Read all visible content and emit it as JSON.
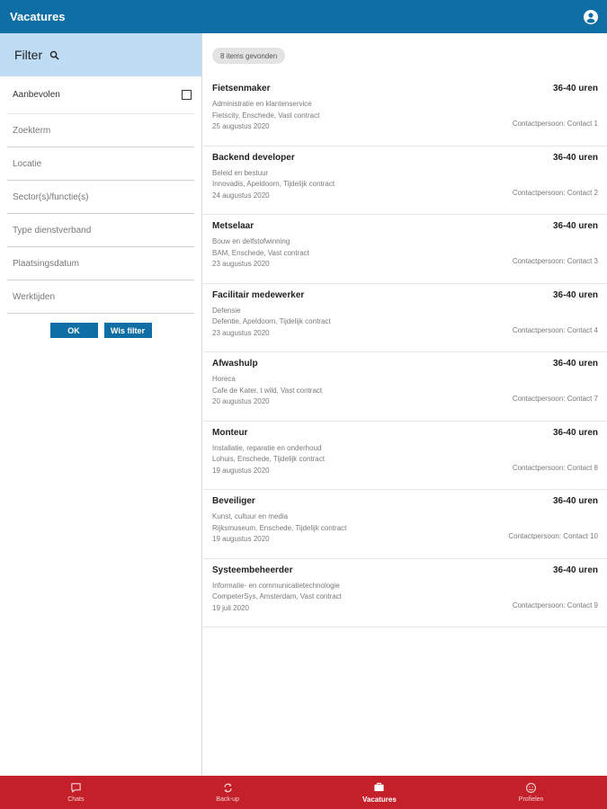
{
  "header": {
    "title": "Vacatures",
    "account_icon": "user-circle-icon"
  },
  "filter": {
    "title": "Filter",
    "search_icon": "search-icon",
    "recommended_label": "Aanbevolen",
    "fields": [
      {
        "placeholder": "Zoekterm"
      },
      {
        "placeholder": "Locatie"
      },
      {
        "placeholder": "Sector(s)/functie(s)"
      },
      {
        "placeholder": "Type dienstverband"
      },
      {
        "placeholder": "Plaatsingsdatum"
      },
      {
        "placeholder": "Werktijden"
      }
    ],
    "ok_label": "OK",
    "clear_label": "Wis filter"
  },
  "results": {
    "count_label": "8 items gevonden",
    "items": [
      {
        "title": "Fietsenmaker",
        "hours": "36-40 uren",
        "sector": "Administratie en klantenservice",
        "details": "Fietscity, Enschede, Vast contract",
        "date": "25 augustus 2020",
        "contact": "Contactpersoon: Contact 1"
      },
      {
        "title": "Backend developer",
        "hours": "36-40 uren",
        "sector": "Beleid en bestuur",
        "details": "Innovadis, Apeldoorn, Tijdelijk contract",
        "date": "24 augustus 2020",
        "contact": "Contactpersoon: Contact 2"
      },
      {
        "title": "Metselaar",
        "hours": "36-40 uren",
        "sector": "Bouw en delfstofwinning",
        "details": "BAM, Enschede, Vast contract",
        "date": "23 augustus 2020",
        "contact": "Contactpersoon: Contact 3"
      },
      {
        "title": "Facilitair medewerker",
        "hours": "36-40 uren",
        "sector": "Defensie",
        "details": "Defentie, Apeldoorn, Tijdelijk contract",
        "date": "23 augustus 2020",
        "contact": "Contactpersoon: Contact 4"
      },
      {
        "title": "Afwashulp",
        "hours": "36-40 uren",
        "sector": "Horeca",
        "details": "Cafe de Kater, t wild, Vast contract",
        "date": "20 augustus 2020",
        "contact": "Contactpersoon: Contact 7"
      },
      {
        "title": "Monteur",
        "hours": "36-40 uren",
        "sector": "Installatie, reparatie en onderhoud",
        "details": "Lohuis, Enschede, Tijdelijk contract",
        "date": "19 augustus 2020",
        "contact": "Contactpersoon: Contact 8"
      },
      {
        "title": "Beveiliger",
        "hours": "36-40 uren",
        "sector": "Kunst, cultuur en media",
        "details": "Rijksmuseum, Enschede, Tijdelijk contract",
        "date": "19 augustus 2020",
        "contact": "Contactpersoon: Contact 10"
      },
      {
        "title": "Systeembeheerder",
        "hours": "36-40 uren",
        "sector": "Informatie- en communicatietechnologie",
        "details": "CompeterSys, Amsterdam, Vast contract",
        "date": "19 juli 2020",
        "contact": "Contactpersoon: Contact 9"
      }
    ]
  },
  "tabs": [
    {
      "label": "Chats",
      "icon": "chat-icon",
      "active": false
    },
    {
      "label": "Back-up",
      "icon": "sync-icon",
      "active": false
    },
    {
      "label": "Vacatures",
      "icon": "briefcase-icon",
      "active": true
    },
    {
      "label": "Profielen",
      "icon": "smiley-icon",
      "active": false
    }
  ],
  "colors": {
    "header": "#0f6ea4",
    "filter_header": "#bfdcf5",
    "tabbar": "#c3202a",
    "button": "#0f6ea4"
  }
}
